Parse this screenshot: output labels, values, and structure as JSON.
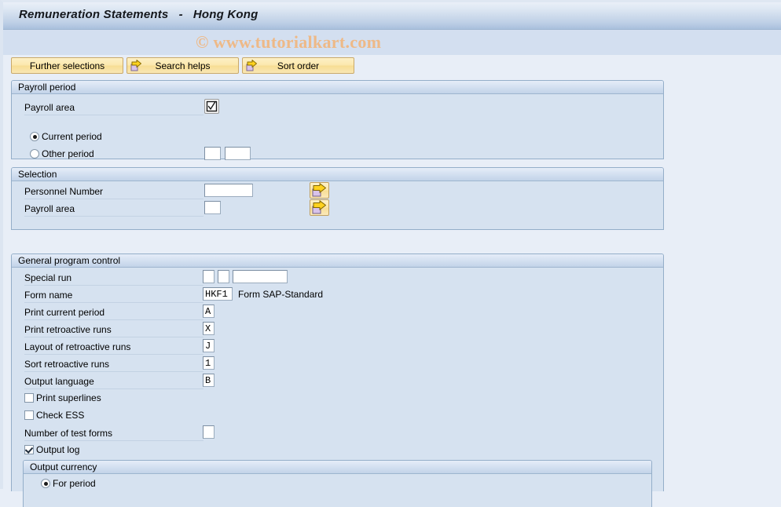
{
  "window": {
    "title": "Remuneration Statements   -   Hong Kong"
  },
  "watermark": {
    "text": "© www.tutorialkart.com",
    "color": "#eeb987"
  },
  "toolbar": {
    "buttons": [
      {
        "label": "Further selections",
        "icon": "none"
      },
      {
        "label": "Search helps",
        "icon": "yellow-arrow-icon"
      },
      {
        "label": "Sort order",
        "icon": "yellow-arrow-icon"
      }
    ]
  },
  "payroll_period": {
    "title": "Payroll period",
    "payroll_area_label": "Payroll area",
    "payroll_area_value": "",
    "value_help_icon": "checkbox-checkmark-icon",
    "current_period": {
      "label": "Current period",
      "selected": true
    },
    "other_period": {
      "label": "Other period",
      "selected": false
    },
    "other_period_value_1": "",
    "other_period_value_2": ""
  },
  "selection": {
    "title": "Selection",
    "rows": [
      {
        "label": "Personnel Number",
        "value": "",
        "arrow_icon": "multiple-selection-arrow-icon"
      },
      {
        "label": "Payroll area",
        "value": "",
        "arrow_icon": "multiple-selection-arrow-icon"
      }
    ]
  },
  "general_program_control": {
    "title": "General program control",
    "special_run": {
      "label": "Special run",
      "value_1": "",
      "value_2": "",
      "value_3": ""
    },
    "form_name": {
      "label": "Form name",
      "value": "HKF1",
      "description": "Form SAP-Standard"
    },
    "print_current_period": {
      "label": "Print current period",
      "value": "A"
    },
    "print_retroactive_runs": {
      "label": "Print retroactive runs",
      "value": "X"
    },
    "layout_of_retroactive_runs": {
      "label": "Layout of retroactive runs",
      "value": "J"
    },
    "sort_retroactive_runs": {
      "label": "Sort retroactive runs",
      "value": "1"
    },
    "output_language": {
      "label": "Output language",
      "value": "B"
    },
    "print_superlines": {
      "label": "Print superlines",
      "checked": false
    },
    "check_ess": {
      "label": "Check ESS",
      "checked": false
    },
    "number_of_test_forms": {
      "label": "Number of test forms",
      "value": ""
    },
    "output_log": {
      "label": "Output log",
      "checked": true
    },
    "output_currency": {
      "title": "Output currency",
      "for_period": {
        "label": "For period",
        "selected": true
      }
    }
  },
  "colors": {
    "page_bg": "#e8eef7",
    "group_bg": "#d6e2f0",
    "titlebar_accent": "#a9c0dd",
    "button_yellow": "#fbe8ad"
  }
}
